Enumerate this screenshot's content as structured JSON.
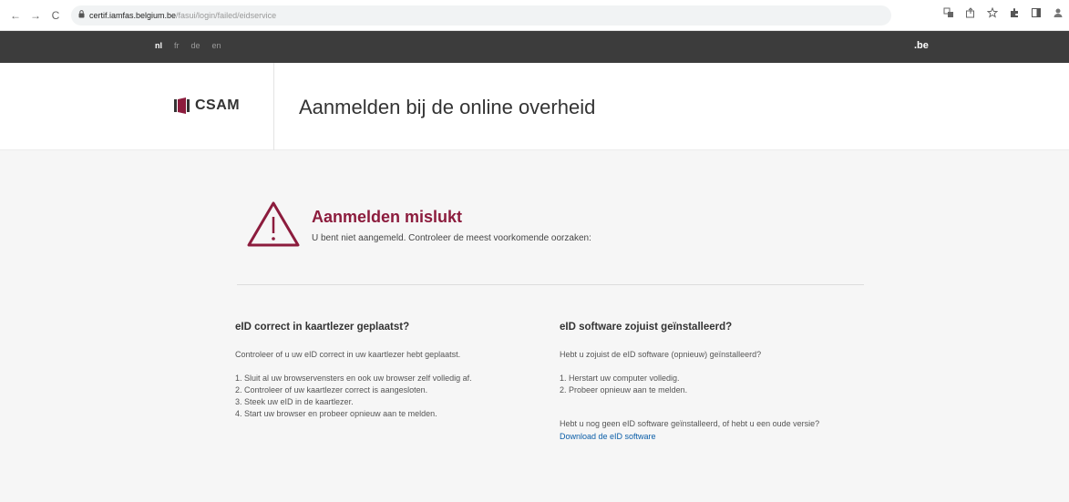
{
  "browser": {
    "back": "←",
    "forward": "→",
    "reload": "C",
    "url_host": "certif.iamfas.belgium.be",
    "url_path": "/fasui/login/failed/eidservice",
    "right_icons": [
      "translate-icon",
      "share-icon",
      "star-icon",
      "extensions-icon",
      "sidepanel-icon",
      "profile-icon"
    ]
  },
  "govbar": {
    "languages": [
      "nl",
      "fr",
      "de",
      "en"
    ],
    "active_language": "nl",
    "logo": ".be"
  },
  "header": {
    "brand": "CSAM",
    "title": "Aanmelden bij de online overheid"
  },
  "alert": {
    "title": "Aanmelden mislukt",
    "text": "U bent niet aangemeld. Controleer de meest voorkomende oorzaken:"
  },
  "left": {
    "heading": "eID correct in kaartlezer geplaatst?",
    "intro": "Controleer of u uw eID correct in uw kaartlezer hebt geplaatst.",
    "steps": [
      "1. Sluit al uw browservensters en ook uw browser zelf volledig af.",
      "2. Controleer of uw kaartlezer correct is aangesloten.",
      "3. Steek uw eID in de kaartlezer.",
      "4. Start uw browser en probeer opnieuw aan te melden."
    ]
  },
  "right": {
    "heading": "eID software zojuist geïnstalleerd?",
    "intro": "Hebt u zojuist de eID software (opnieuw) geïnstalleerd?",
    "steps": [
      "1. Herstart uw computer volledig.",
      "2. Probeer opnieuw aan te melden."
    ],
    "note": "Hebt u nog geen eID software geïnstalleerd, of hebt u een oude versie?",
    "link": "Download de eID software"
  },
  "colors": {
    "accent": "#8c1c3d",
    "govbar": "#3c3c3c",
    "link": "#0b5ea8"
  }
}
